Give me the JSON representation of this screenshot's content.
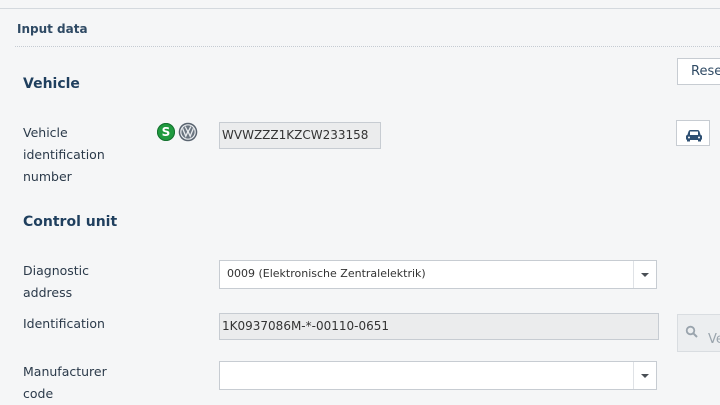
{
  "panel": {
    "title": "Input data"
  },
  "vehicle": {
    "heading": "Vehicle",
    "vin_label_lines": [
      "Vehicle",
      "identification",
      "number"
    ],
    "vin_value": "WVWZZZ1KZCW233158",
    "badge_s": "S",
    "brand_icon": "vw-logo-icon"
  },
  "control_unit": {
    "heading": "Control unit",
    "diag_label_lines": [
      "Diagnostic",
      "address"
    ],
    "diag_value": "0009 (Elektronische Zentralelektrik)",
    "ident_label": "Identification",
    "ident_value": "1K0937086M-*-00110-0651",
    "manuf_label_lines": [
      "Manufacturer",
      "code"
    ],
    "manuf_value": ""
  },
  "buttons": {
    "reset": "Rese",
    "verify": "Ve"
  },
  "colors": {
    "heading": "#1f3f5e",
    "badge_green": "#1f9a3f",
    "field_border": "#c7ccd2"
  }
}
